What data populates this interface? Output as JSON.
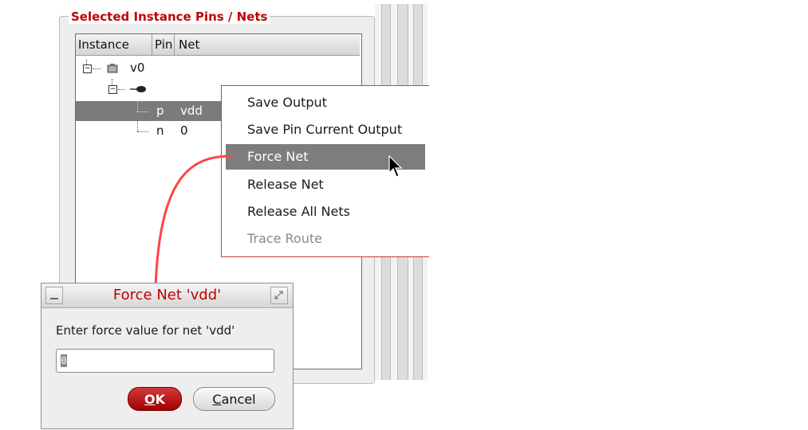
{
  "group": {
    "title": "Selected Instance Pins / Nets"
  },
  "tree": {
    "columns": [
      "Instance",
      "Pin",
      "Net"
    ],
    "rows": [
      {
        "instance": "v0",
        "pin": "",
        "net": ""
      },
      {
        "instance": "",
        "pin": "",
        "net": ""
      },
      {
        "instance": "",
        "pin": "p",
        "net": "vdd"
      },
      {
        "instance": "",
        "pin": "n",
        "net": "0"
      }
    ]
  },
  "context_menu": {
    "items": [
      {
        "label": "Save Output",
        "state": "normal"
      },
      {
        "label": "Save Pin Current Output",
        "state": "normal"
      },
      {
        "label": "Force Net",
        "state": "highlighted"
      },
      {
        "label": "Release Net",
        "state": "normal"
      },
      {
        "label": "Release All Nets",
        "state": "normal"
      },
      {
        "label": "Trace Route",
        "state": "disabled"
      }
    ]
  },
  "dialog": {
    "title": "Force Net 'vdd'",
    "prompt": "Enter force value for net 'vdd'",
    "input_value": "0",
    "ok_rest": "K",
    "ok_mnemonic": "O",
    "cancel_mnemonic": "C",
    "cancel_rest": "ancel"
  },
  "colors": {
    "accent_red": "#c00000",
    "arrow_red": "#ff4444",
    "selection_gray": "#7b7b7b"
  }
}
